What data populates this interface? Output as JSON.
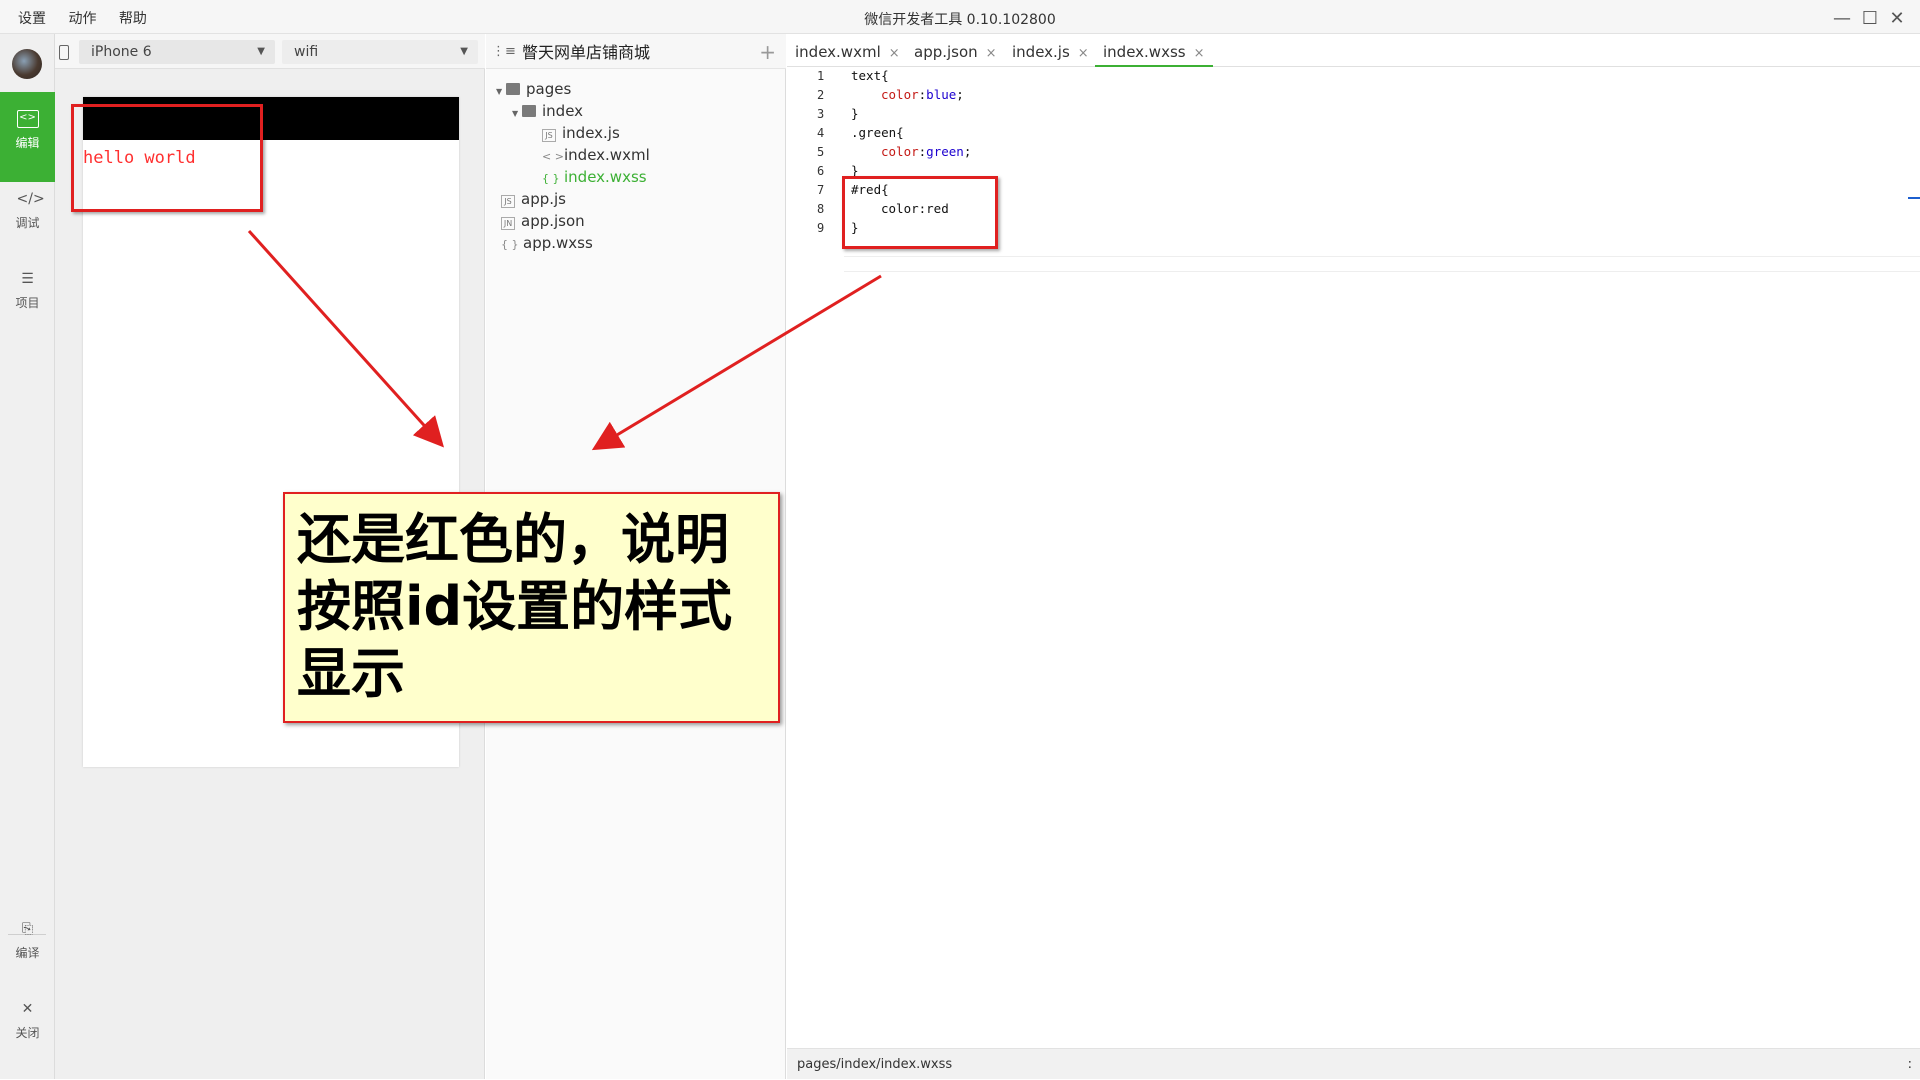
{
  "menu": {
    "items": [
      "设置",
      "动作",
      "帮助"
    ],
    "app_title": "微信开发者工具 0.10.102800"
  },
  "window_controls": {
    "minimize": "—",
    "maximize": "☐",
    "close": "✕"
  },
  "sidebar": {
    "items": [
      {
        "label": "编辑",
        "icon": "code-icon",
        "active": true
      },
      {
        "label": "调试",
        "icon": "debug-icon",
        "active": false
      },
      {
        "label": "项目",
        "icon": "project-icon",
        "active": false
      },
      {
        "label": "编译",
        "icon": "compile-icon",
        "active": false
      },
      {
        "label": "关闭",
        "icon": "close-icon",
        "active": false
      }
    ]
  },
  "simulator": {
    "device": "iPhone 6",
    "network": "wifi",
    "page_text": "hello world"
  },
  "tree": {
    "project_name": "瞥天网单店铺商城",
    "nodes": [
      {
        "label": "pages"
      },
      {
        "label": "index"
      },
      {
        "label": "index.js",
        "badge": "JS"
      },
      {
        "label": "index.wxml",
        "badge": "< >"
      },
      {
        "label": "index.wxss",
        "badge": "{ }",
        "selected": true
      },
      {
        "label": "app.js",
        "badge": "JS"
      },
      {
        "label": "app.json",
        "badge": "JN"
      },
      {
        "label": "app.wxss",
        "badge": "{ }"
      }
    ]
  },
  "editor": {
    "tabs": [
      {
        "label": "index.wxml",
        "close": "×"
      },
      {
        "label": "app.json",
        "close": "×"
      },
      {
        "label": "index.js",
        "close": "×"
      },
      {
        "label": "index.wxss",
        "close": "×",
        "active": true
      }
    ],
    "line_numbers": [
      "1",
      "2",
      "3",
      "4",
      "5",
      "6",
      "7",
      "8",
      "9"
    ],
    "code": {
      "l1": "text{",
      "l2_prop": "color",
      "l2_val": "blue",
      "l3": "}",
      "l4": ".green{",
      "l5_prop": "color",
      "l5_val": "green",
      "l6": "}",
      "l7": "#red{",
      "l8": "color:red",
      "l9": "}"
    },
    "status_path": "pages/index/index.wxss",
    "status_right": ":"
  },
  "annotation": {
    "callout_text": "还是红色的，说明按照id设置的样式显示"
  },
  "colors": {
    "accent_green": "#3cb034",
    "annotation_red": "#e02020",
    "callout_bg": "#ffffcc"
  }
}
